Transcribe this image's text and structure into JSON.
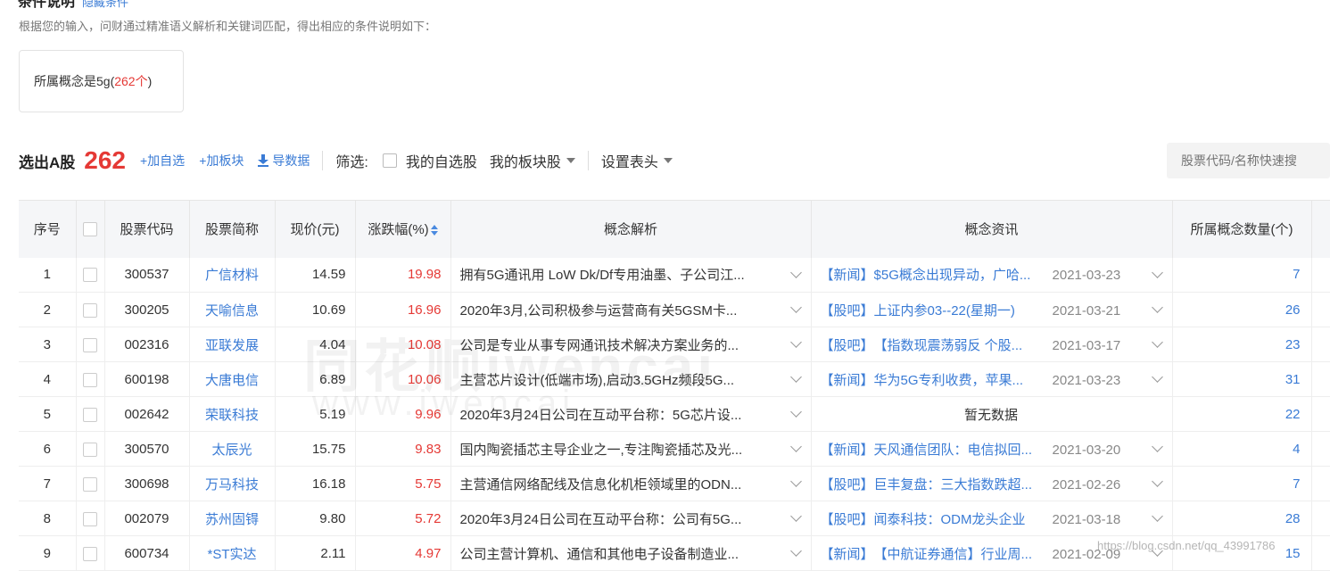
{
  "header": {
    "title": "条件说明",
    "title_link": "隐藏条件",
    "description": "根据您的输入，问财通过精准语义解析和关键词匹配，得出相应的条件说明如下：",
    "condition_text": "所属概念是5g(",
    "condition_count": "262个",
    "condition_close": ")"
  },
  "toolbar": {
    "label": "选出A股",
    "count": "262",
    "add_watchlist": "+加自选",
    "add_sector": "+加板块",
    "export": "导数据",
    "filter_label": "筛选:",
    "my_watchlist": "我的自选股",
    "my_sector": "我的板块股",
    "set_header": "设置表头",
    "search_placeholder": "股票代码/名称快速搜"
  },
  "table": {
    "headers": {
      "index": "序号",
      "code": "股票代码",
      "name": "股票简称",
      "price": "现价(元)",
      "change": "涨跌幅(%)",
      "concept_analysis": "概念解析",
      "concept_news": "概念资讯",
      "concept_count": "所属概念数量(个)"
    },
    "rows": [
      {
        "index": "1",
        "code": "300537",
        "name": "广信材料",
        "price": "14.59",
        "change": "19.98",
        "desc": "拥有5G通讯用 LoW Dk/Df专用油墨、子公司江...",
        "news_src": "【新闻】",
        "news_title": "$5G概念出现异动，广哈...",
        "news_date": "2021-03-23",
        "count": "7"
      },
      {
        "index": "2",
        "code": "300205",
        "name": "天喻信息",
        "price": "10.69",
        "change": "16.96",
        "desc": "2020年3月,公司积极参与运营商有关5GSM卡...",
        "news_src": "【股吧】",
        "news_title": "上证内参03--22(星期一)",
        "news_date": "2021-03-21",
        "count": "26"
      },
      {
        "index": "3",
        "code": "002316",
        "name": "亚联发展",
        "price": "4.04",
        "change": "10.08",
        "desc": "公司是专业从事专网通讯技术解决方案业务的...",
        "news_src": "【股吧】",
        "news_title": "【指数现震荡弱反 个股...",
        "news_date": "2021-03-17",
        "count": "23"
      },
      {
        "index": "4",
        "code": "600198",
        "name": "大唐电信",
        "price": "6.89",
        "change": "10.06",
        "desc": "主营芯片设计(低端市场),启动3.5GHz频段5G...",
        "news_src": "【新闻】",
        "news_title": "华为5G专利收费，苹果...",
        "news_date": "2021-03-23",
        "count": "31"
      },
      {
        "index": "5",
        "code": "002642",
        "name": "荣联科技",
        "price": "5.19",
        "change": "9.96",
        "desc": "2020年3月24日公司在互动平台称：5G芯片设...",
        "news_src": "",
        "news_title": "",
        "news_date": "",
        "news_empty": "暂无数据",
        "count": "22"
      },
      {
        "index": "6",
        "code": "300570",
        "name": "太辰光",
        "price": "15.75",
        "change": "9.83",
        "desc": "国内陶瓷插芯主导企业之一,专注陶瓷插芯及光...",
        "news_src": "【新闻】",
        "news_title": "天风通信团队：电信拟回...",
        "news_date": "2021-03-20",
        "count": "4"
      },
      {
        "index": "7",
        "code": "300698",
        "name": "万马科技",
        "price": "16.18",
        "change": "5.75",
        "desc": "主营通信网络配线及信息化机柜领域里的ODN...",
        "news_src": "【股吧】",
        "news_title": "巨丰复盘：三大指数跌超...",
        "news_date": "2021-02-26",
        "count": "7"
      },
      {
        "index": "8",
        "code": "002079",
        "name": "苏州固锝",
        "price": "9.80",
        "change": "5.72",
        "desc": "2020年3月24日公司在互动平台称：公司有5G...",
        "news_src": "【股吧】",
        "news_title": "闻泰科技：ODM龙头企业",
        "news_date": "2021-03-18",
        "count": "28"
      },
      {
        "index": "9",
        "code": "600734",
        "name": "*ST实达",
        "price": "2.11",
        "change": "4.97",
        "desc": "公司主营计算机、通信和其他电子设备制造业...",
        "news_src": "【新闻】",
        "news_title": "【中航证券通信】行业周...",
        "news_date": "2021-02-09",
        "count": "15"
      }
    ]
  },
  "watermark": {
    "cn": "同花顺iwencai",
    "url": "www.iwencai",
    "csdn": "https://blog.csdn.net/qq_43991786"
  },
  "colors": {
    "accent": "#3a7bd5",
    "up": "#e53935",
    "header_bg": "#f5f6f8"
  }
}
